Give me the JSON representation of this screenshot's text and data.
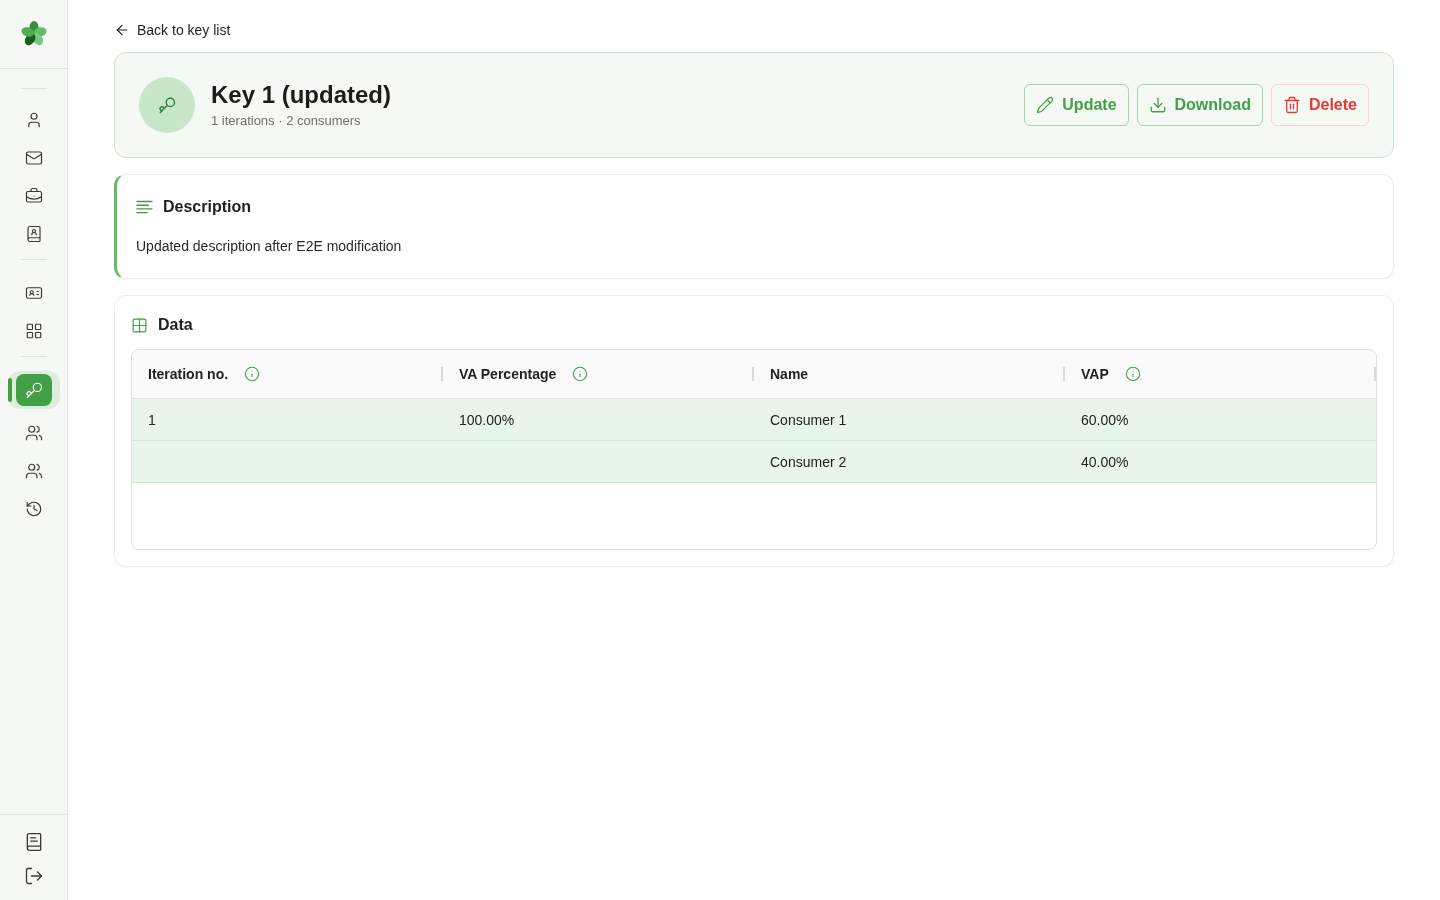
{
  "sidebar": {
    "groups": [
      {
        "items": [
          {
            "selected": false
          },
          {
            "selected": false
          },
          {
            "selected": false
          },
          {
            "selected": false
          }
        ]
      },
      {
        "items": [
          {
            "selected": false
          },
          {
            "selected": false
          }
        ]
      },
      {
        "items": [
          {
            "selected": true
          },
          {
            "selected": false
          },
          {
            "selected": false
          },
          {
            "selected": false
          }
        ]
      }
    ]
  },
  "back_link": {
    "label": "Back to key list"
  },
  "key_header": {
    "title": "Key 1 (updated)",
    "subtitle": "1 iterations · 2 consumers",
    "buttons": [
      {
        "label": "Update",
        "kind": "edit"
      },
      {
        "label": "Download",
        "kind": "download"
      },
      {
        "label": "Delete",
        "kind": "delete"
      }
    ]
  },
  "description": {
    "title": "Description",
    "text": "Updated description after E2E modification"
  },
  "data": {
    "title": "Data",
    "table": {
      "columns": [
        {
          "label": "Iteration no.",
          "info": true
        },
        {
          "label": "VA Percentage",
          "info": true
        },
        {
          "label": "Name",
          "info": false
        },
        {
          "label": "VAP",
          "info": true
        }
      ],
      "iterations": [
        {
          "iteration_no": "1",
          "va_percentage": "100.00%",
          "consumers": [
            {
              "name": "Consumer 1",
              "vap": "60.00%"
            },
            {
              "name": "Consumer 2",
              "vap": "40.00%"
            }
          ]
        }
      ]
    }
  }
}
